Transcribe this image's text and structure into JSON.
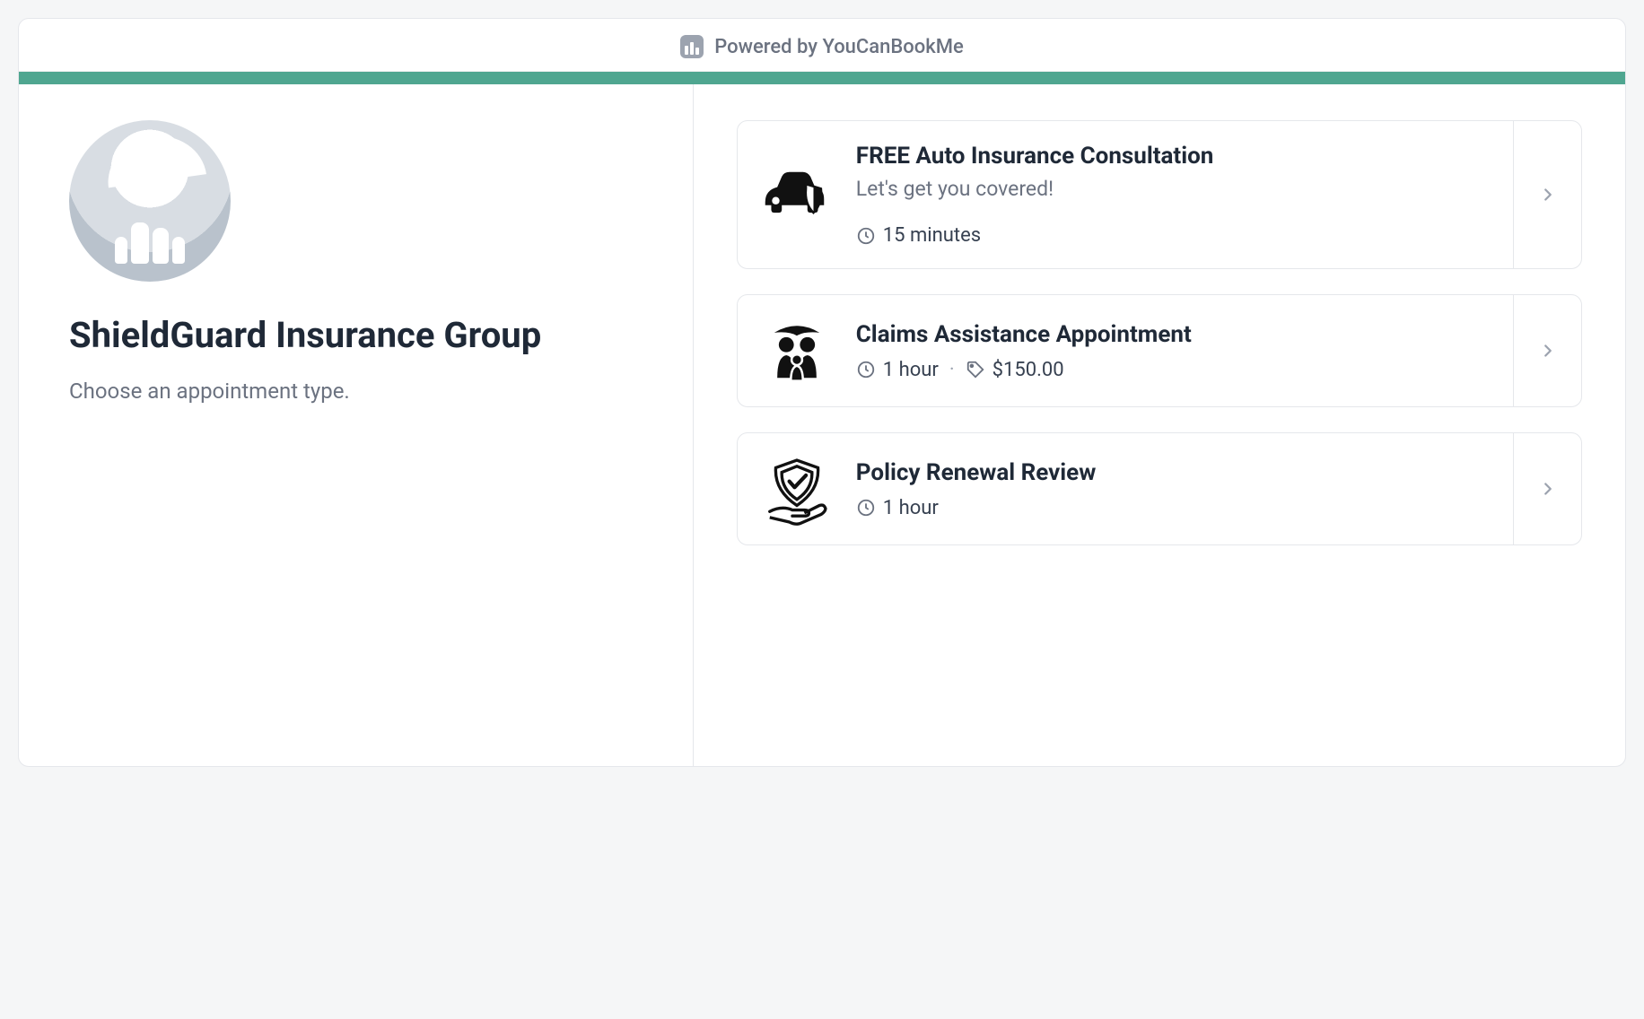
{
  "header": {
    "powered_by": "Powered by YouCanBookMe"
  },
  "profile": {
    "name": "ShieldGuard Insurance Group",
    "subtitle": "Choose an appointment type."
  },
  "appointments": [
    {
      "icon": "car-shield",
      "title": "FREE Auto Insurance Consultation",
      "description": "Let's get you covered!",
      "duration": "15 minutes",
      "price": null
    },
    {
      "icon": "family-umbrella",
      "title": "Claims Assistance Appointment",
      "description": null,
      "duration": "1 hour",
      "price": "$150.00"
    },
    {
      "icon": "shield-hand",
      "title": "Policy Renewal Review",
      "description": null,
      "duration": "1 hour",
      "price": null
    }
  ],
  "colors": {
    "accent": "#4fa690"
  }
}
